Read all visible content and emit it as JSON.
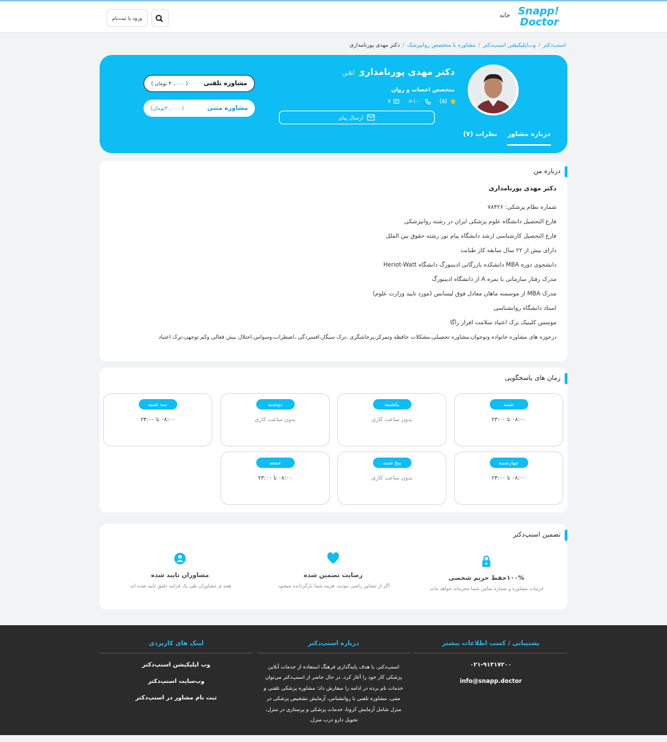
{
  "header": {
    "logo_line1": "Snapp!",
    "logo_line2": "Doctor",
    "home_label": "خانه",
    "login_label": "ورود یا ثبت‌نام",
    "search_icon": "search-icon"
  },
  "breadcrumb": {
    "items": [
      "اسنپ‌دکتر",
      "وب‌اپلیکیشن اسنپ‌دکتر",
      "مشاوره با متخصص روانپزشک"
    ],
    "current": "دکتر مهدی پورنامداری"
  },
  "profile": {
    "name": "دکتر مهدی پورنامداری",
    "status": "آنلاین",
    "specialty": "متخصص اعصاب و روان",
    "rating": "(۵)",
    "calls": "۱۰۰<",
    "messages": "۷",
    "send_message": "ارسال پیام",
    "phone_consult": {
      "label": "مشاوره تلفنی",
      "price": "( ۴۰,۰۰۰ تومان )"
    },
    "text_consult": {
      "label": "مشاوره متنی",
      "price": "( ۳۰,۰۰۰تومان)"
    },
    "tabs": {
      "about": "درباره مشاور",
      "reviews": "نظرات (۷)"
    },
    "colors": {
      "brand": "#0dbdf3",
      "online": "#1bd16d",
      "star": "#f5c518"
    }
  },
  "about": {
    "title": "درباره من",
    "name": "دکتر مهدی پورنامداری",
    "lines": [
      "شماره نظام پزشکی: ۷۸۴۲۶",
      "فارغ التحصیل دانشگاه علوم پزشکی ایران در رشته روانپزشکی",
      "فارغ التحصیل کارشناسی ارشد دانشگاه پیام نور رشته حقوق بین الملل",
      "دارای بیش از ۲۲ سال سابقه کار طبابت",
      "دانشجوی دوره MBA دانشکده بازرگانی ادینبورگ دانشگاه Heriot-Watt",
      "مدرک رفتار سازمانی با نمره A از دانشگاه ادینبورگ",
      "مدرک MBA از موسسه ماهان معادل فوق لیسانس (مورد تایید وزارت علوم)",
      "استاد دانشگاه روانشناسی",
      "موسس کلینیک ترک اعتیاد سلامت افراز راگا",
      "درحوزه های مشاوره خانواده وتوجوان،مشاوره تحصیلی،مشکلات حافظه وتمرکز،پرخاشگری ،ترک سیگار،افسردگی ،اضطراب،وسواس،اختلال بیش فعالی وکم توجهی،ترک اعتیاد"
    ]
  },
  "schedule": {
    "title": "زمان های پاسخگویی",
    "days": [
      {
        "day": "شنبه",
        "hours": "۰۸:۰۰  تا  ۲۳:۰۰"
      },
      {
        "day": "یکشنبه",
        "hours": "بدون ساعت کاری"
      },
      {
        "day": "دوشنبه",
        "hours": "بدون ساعت کاری"
      },
      {
        "day": "سه شنبه",
        "hours": "۰۸:۰۰  تا  ۲۴:۰۰"
      },
      {
        "day": "چهارشنبه",
        "hours": "۰۸:۰۰  تا  ۲۴:۰۰"
      },
      {
        "day": "پنج شنبه",
        "hours": "بدون ساعت کاری"
      },
      {
        "day": "جمعه",
        "hours": "۰۸:۰۰  تا  ۲۳:۰۰"
      }
    ]
  },
  "guarantee": {
    "title": "تضمین اسنپ‌دکتر",
    "items": [
      {
        "icon": "lock-icon",
        "title": "۱۰۰%حفظ حریم شخصی",
        "desc": "جزئیات مشاوره و شماره تماس شما محرمانه خواهد ماند."
      },
      {
        "icon": "heart-icon",
        "title": "رضایت تضمین شده",
        "desc": "اگر از مشاور راضی نبودید، هزینه شما بازگردانده میشود."
      },
      {
        "icon": "user-verified-icon",
        "title": "مشاوران تایید شده",
        "desc": "همه ی مشاوران طی یک فرایند دقیق تایید شده اند."
      }
    ]
  },
  "footer": {
    "support": {
      "title": "پشتیبانی / کسب اطلاعات بیشتر",
      "phone": "۰۲۱-۹۱۳۱۷۲۰۰",
      "email": "info@snapp.doctor"
    },
    "about": {
      "title": "درباره اسنپ‌دکتر",
      "lines": [
        "اسنپ‌دکتر، با هدف پایه‌گذاری فرهنگ استفاده از خدمات آنلاین",
        "پزشکی کار خود را آغاز کرد. در حال حاضر از اسنپ‌دکتر می‌توان",
        "خدمات نام برده در ادامه را سفارش داد: مشاوره پزشکی تلفنی و",
        "متنی، مشاوره تلفنی با روانشناس، آزمایش تشخیص پزشکی در",
        "منزل شامل آزمایش کرونا، خدمات پزشکی و پرستاری در منزل،",
        "تحویل دارو درب منزل."
      ]
    },
    "links": {
      "title": "لینک های کاربردی",
      "items": [
        "وب اپلیکیشن اسنپ‌دکتر",
        "وب‌سایت اسنپ‌دکتر",
        "ثبت نام مشاور در اسنپ‌دکتر"
      ]
    }
  }
}
